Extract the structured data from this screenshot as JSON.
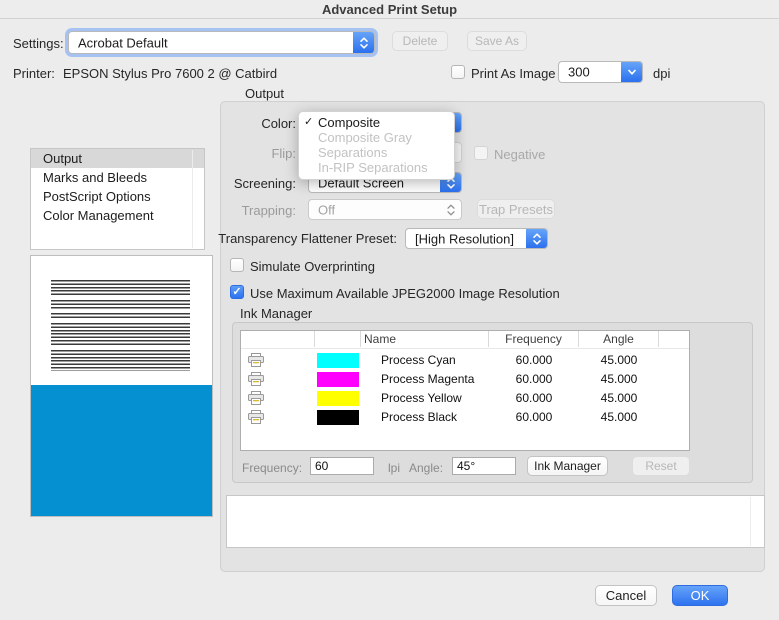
{
  "window": {
    "title": "Advanced Print Setup"
  },
  "header": {
    "settings_label": "Settings:",
    "settings_value": "Acrobat Default",
    "delete_button": "Delete",
    "save_as_button": "Save As",
    "printer_label": "Printer:",
    "printer_value": "EPSON Stylus Pro 7600 2 @ Catbird",
    "print_as_image_label": "Print As Image",
    "dpi_value": "300",
    "dpi_label": "dpi"
  },
  "sidebar": {
    "items": [
      {
        "label": "Output",
        "selected": true
      },
      {
        "label": "Marks and Bleeds",
        "selected": false
      },
      {
        "label": "PostScript Options",
        "selected": false
      },
      {
        "label": "Color Management",
        "selected": false
      }
    ]
  },
  "output_panel": {
    "title": "Output",
    "color_label": "Color:",
    "flip_label": "Flip:",
    "negative_label": "Negative",
    "screening_label": "Screening:",
    "screening_value": "Default Screen",
    "trapping_label": "Trapping:",
    "trapping_value": "Off",
    "trap_presets_button": "Trap Presets",
    "flattener_label": "Transparency Flattener Preset:",
    "flattener_value": "[High Resolution]",
    "simulate_overprinting_label": "Simulate Overprinting",
    "jpeg2000_label": "Use Maximum Available JPEG2000 Image Resolution",
    "jpeg2000_checkmark": "✓"
  },
  "color_menu": {
    "items": [
      {
        "label": "Composite",
        "checked": "✓",
        "enabled": true
      },
      {
        "label": "Composite Gray",
        "checked": "",
        "enabled": false
      },
      {
        "label": "Separations",
        "checked": "",
        "enabled": false
      },
      {
        "label": "In-RIP Separations",
        "checked": "",
        "enabled": false
      }
    ]
  },
  "ink_manager": {
    "section_label": "Ink Manager",
    "columns": {
      "name": "Name",
      "frequency": "Frequency",
      "angle": "Angle"
    },
    "rows": [
      {
        "name": "Process Cyan",
        "frequency": "60.000",
        "angle": "45.000",
        "color": "#00ffff"
      },
      {
        "name": "Process Magenta",
        "frequency": "60.000",
        "angle": "45.000",
        "color": "#ff00ff"
      },
      {
        "name": "Process Yellow",
        "frequency": "60.000",
        "angle": "45.000",
        "color": "#ffff00"
      },
      {
        "name": "Process Black",
        "frequency": "60.000",
        "angle": "45.000",
        "color": "#000000"
      }
    ],
    "frequency_label": "Frequency:",
    "frequency_value": "60",
    "lpi_label": "lpi",
    "angle_label": "Angle:",
    "angle_value": "45°",
    "ink_manager_button": "Ink Manager",
    "reset_button": "Reset"
  },
  "footer": {
    "cancel_button": "Cancel",
    "ok_button": "OK"
  },
  "colors": {
    "accent_blue": "#2e72f0",
    "preview_page_blue": "#0590d2"
  }
}
